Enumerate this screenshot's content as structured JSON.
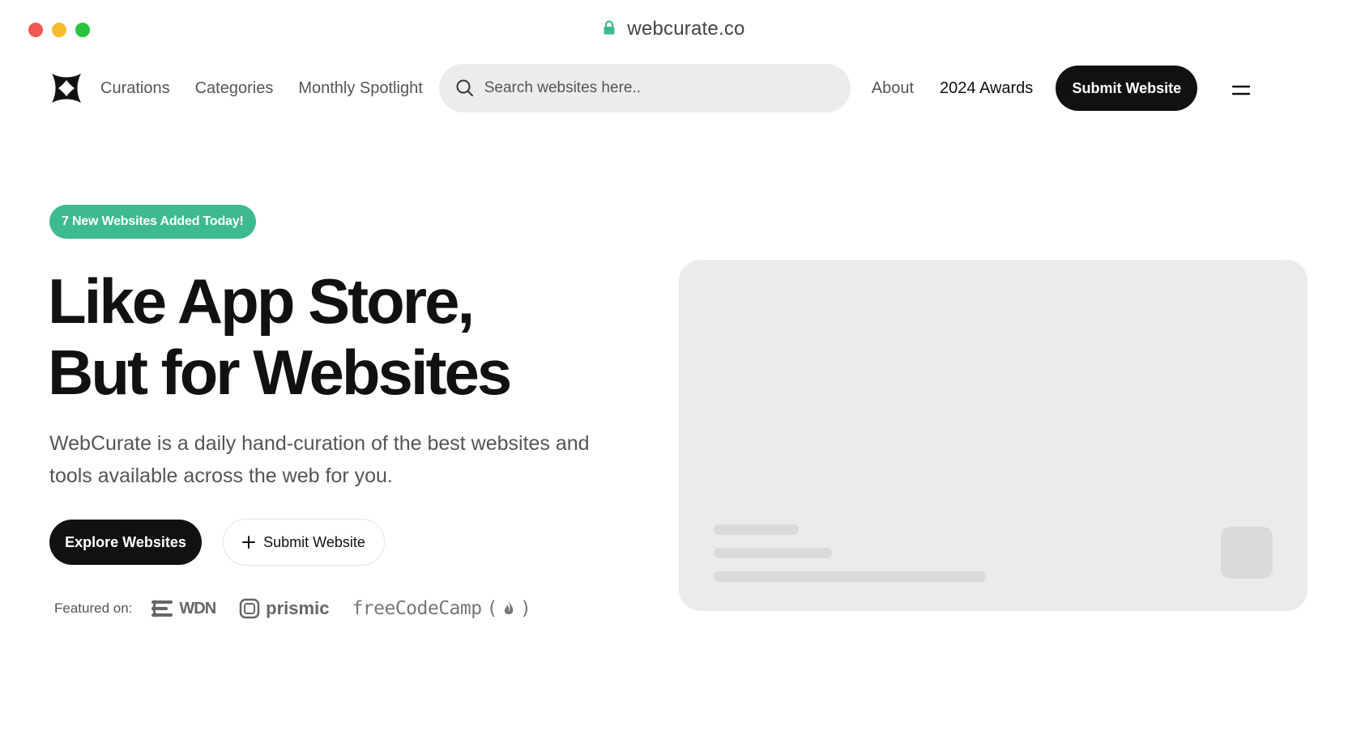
{
  "browser": {
    "url": "webcurate.co",
    "icons": {
      "lock": "lock-icon"
    },
    "colors": {
      "close": "#ee5a52",
      "minimize": "#f5bd2e",
      "maximize": "#27c43f",
      "lock": "#3dba8f"
    }
  },
  "nav": {
    "logo": "webcurate-logo",
    "links": [
      "Curations",
      "Categories",
      "Monthly Spotlight"
    ],
    "search_placeholder": "Search websites here..",
    "about": "About",
    "awards": "2024 Awards",
    "submit": "Submit Website",
    "menu_icon": "menu-icon"
  },
  "hero": {
    "badge": "7 New Websites Added Today!",
    "badge_color": "#3dba8f",
    "headline_line1": "Like App Store,",
    "headline_line2": "But for Websites",
    "subtitle": "WebCurate is a daily hand-curation of the best websites and tools available across the web for you.",
    "explore_button": "Explore Websites",
    "submit_button": "Submit Website",
    "submit_icon": "plus-icon"
  },
  "featured": {
    "label": "Featured on:",
    "brands": [
      "WDN",
      "prismic",
      "freeCodeCamp"
    ]
  },
  "preview": {
    "state": "loading-skeleton"
  }
}
